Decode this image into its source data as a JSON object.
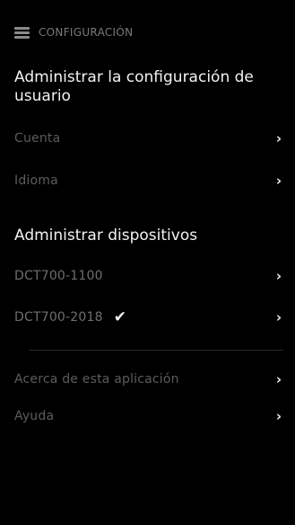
{
  "header": {
    "menu_icon": "hamburger-menu-icon",
    "title": "CONFIGURACIÓN"
  },
  "user_settings": {
    "title": "Administrar la configuración de usuario",
    "items": [
      {
        "label": "Cuenta"
      },
      {
        "label": "Idioma"
      }
    ]
  },
  "devices": {
    "title": "Administrar dispositivos",
    "items": [
      {
        "label": "DCT700-1100",
        "selected": false
      },
      {
        "label": "DCT700-2018",
        "selected": true
      }
    ]
  },
  "other": {
    "items": [
      {
        "label": "Acerca de esta aplicación"
      },
      {
        "label": "Ayuda"
      }
    ]
  },
  "icons": {
    "chevron": "›",
    "check": "✔"
  },
  "colors": {
    "background": "#000000",
    "heading": "#f2f2f2",
    "item_text": "#5c5c5c",
    "accent_white": "#f0f0f0"
  }
}
